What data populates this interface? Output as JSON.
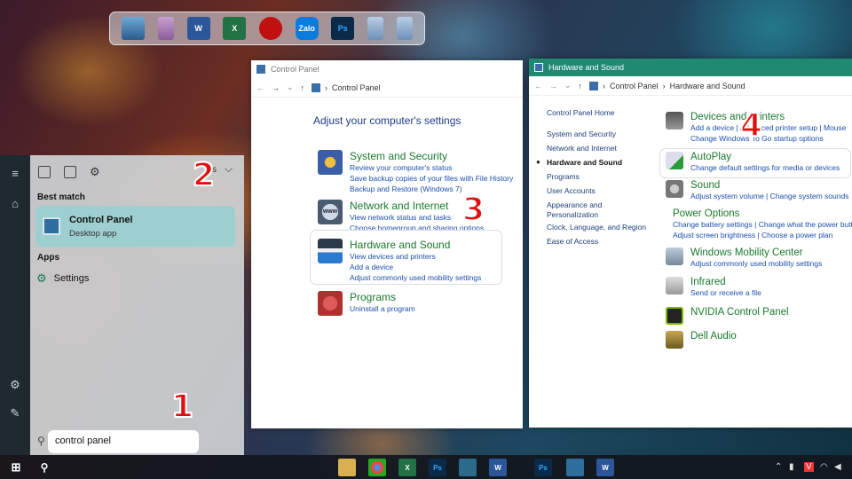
{
  "dock": {
    "apps": [
      "monitor-icon",
      "recycle-bin-icon",
      "word-icon",
      "excel-icon",
      "garena-icon",
      "zalo-icon",
      "photoshop-icon",
      "window-panel-icon",
      "window-panel-icon"
    ],
    "labels": {
      "word": "W",
      "excel": "X",
      "zalo": "Zalo",
      "ps": "Ps"
    }
  },
  "start": {
    "best_match_label": "Best match",
    "apps_label": "Apps",
    "best_match": {
      "title": "Control Panel",
      "subtitle": "Desktop app"
    },
    "apps": [
      {
        "label": "Settings"
      }
    ],
    "filter_label": "s",
    "search_value": "control panel"
  },
  "window1": {
    "title": "Control Panel",
    "address": "Control Panel",
    "heading": "Adjust your computer's settings",
    "categories": [
      {
        "title": "System and Security",
        "links": [
          "Review your computer's status",
          "Save backup copies of your files with File History",
          "Backup and Restore (Windows 7)"
        ],
        "color": "#3b5ea8"
      },
      {
        "title": "Network and Internet",
        "links": [
          "View network status and tasks",
          "Choose homegroup and sharing options"
        ],
        "color": "#4a5a70"
      },
      {
        "title": "Hardware and Sound",
        "links": [
          "View devices and printers",
          "Add a device",
          "Adjust commonly used mobility settings"
        ],
        "color": "#2a3a4a"
      },
      {
        "title": "Programs",
        "links": [
          "Uninstall a program"
        ],
        "color": "#b03030"
      }
    ]
  },
  "window2": {
    "title": "Hardware and Sound",
    "breadcrumb": [
      "Control Panel",
      "Hardware and Sound"
    ],
    "side": [
      "Control Panel Home",
      "System and Security",
      "Network and Internet",
      "Hardware and Sound",
      "Programs",
      "User Accounts",
      "Appearance and Personalization",
      "Clock, Language, and Region",
      "Ease of Access"
    ],
    "items": [
      {
        "title": "Devices and Printers",
        "links": [
          "Add a device",
          "Advanced printer setup",
          "Mouse",
          "Change Windows To Go startup options"
        ]
      },
      {
        "title": "AutoPlay",
        "links": [
          "Change default settings for media or devices"
        ]
      },
      {
        "title": "Sound",
        "links": [
          "Adjust system volume",
          "Change system sounds"
        ]
      },
      {
        "title": "Power Options",
        "links": [
          "Change battery settings",
          "Change what the power buttons do",
          "Adjust screen brightness",
          "Choose a power plan"
        ]
      },
      {
        "title": "Windows Mobility Center",
        "links": [
          "Adjust commonly used mobility settings"
        ]
      },
      {
        "title": "Infrared",
        "links": [
          "Send or receive a file"
        ]
      },
      {
        "title": "NVIDIA Control Panel",
        "links": []
      },
      {
        "title": "Dell Audio",
        "links": []
      }
    ]
  },
  "steps": [
    "1",
    "2",
    "3",
    "4"
  ],
  "taskbar": {
    "labels": {
      "ps": "Ps",
      "word": "W",
      "excel": "X"
    }
  }
}
